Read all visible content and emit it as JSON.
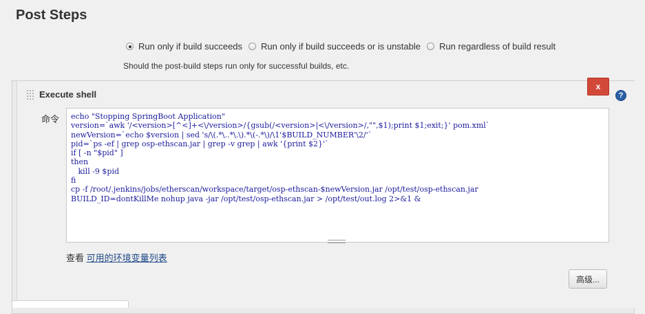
{
  "section": {
    "title": "Post Steps"
  },
  "run_condition": {
    "options": [
      {
        "label": "Run only if build succeeds",
        "checked": true
      },
      {
        "label": "Run only if build succeeds or is unstable",
        "checked": false
      },
      {
        "label": "Run regardless of build result",
        "checked": false
      }
    ],
    "help_text": "Should the post-build steps run only for successful builds, etc."
  },
  "step": {
    "title": "Execute shell",
    "delete_label": "x",
    "help_label": "?",
    "command_label": "命令",
    "command": "echo \"Stopping SpringBoot Application\"\nversion=`awk '/<version>[^<]+<\\/version>/{gsub(/<version>|<\\/version>/,\"\",$1);print $1;exit;}' pom.xml`\nnewVersion=`echo $version | sed 's/\\(.*\\..*\\.\\).*\\(-.*\\)/\\1'$BUILD_NUMBER'\\2/'`\npid=`ps -ef | grep osp-ethscan.jar | grep -v grep | awk '{print $2}'`\nif [ -n \"$pid\" ]\nthen\n   kill -9 $pid\nfi\ncp -f /root/.jenkins/jobs/etherscan/workspace/target/osp-ethscan-$newVersion.jar /opt/test/osp-ethscan.jar\nBUILD_ID=dontKillMe nohup java -jar /opt/test/osp-ethscan.jar > /opt/test/out.log 2>&1 &",
    "env_prefix": "查看 ",
    "env_link": "可用的环境变量列表",
    "advanced_label": "高级..."
  }
}
